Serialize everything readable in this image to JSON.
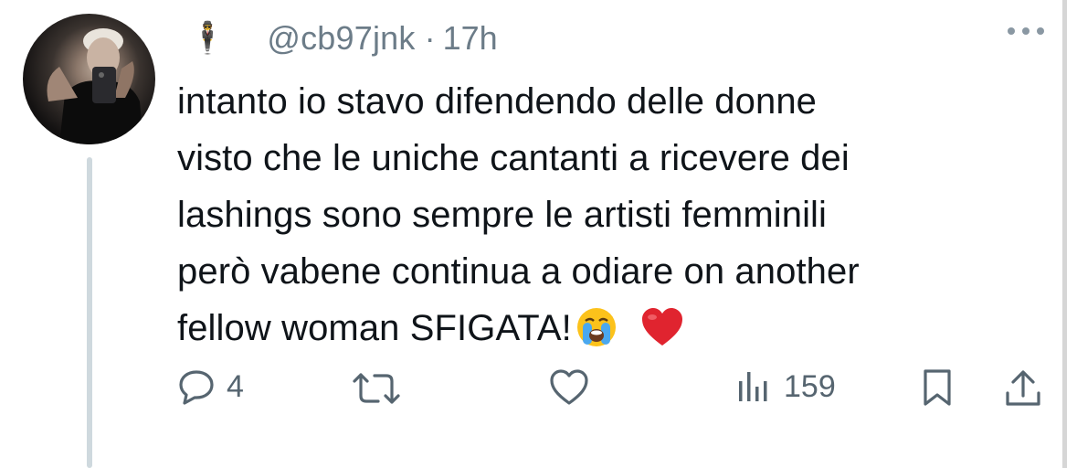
{
  "author": {
    "emoji": "🕴",
    "handle": "@cb97jnk",
    "separator": "·",
    "time": "17h"
  },
  "tweet": {
    "text": "intanto io stavo difendendo delle donne\nvisto che le uniche cantanti a ricevere dei\nlashings sono sempre le artisti femminili\nperò vabene continua a odiare on another\nfellow woman SFIGATA!"
  },
  "actions": {
    "reply_count": "4",
    "views_count": "159"
  },
  "icons": [
    "man-in-suit-emoji",
    "more-icon",
    "crying-face-emoji",
    "heart-emoji",
    "reply-icon",
    "retweet-icon",
    "like-icon",
    "views-icon",
    "bookmark-icon",
    "share-icon"
  ],
  "colors": {
    "secondary_text": "#6c7c88",
    "icon": "#566570",
    "thread_line": "#cfd9de",
    "heart": "#e0242f"
  }
}
